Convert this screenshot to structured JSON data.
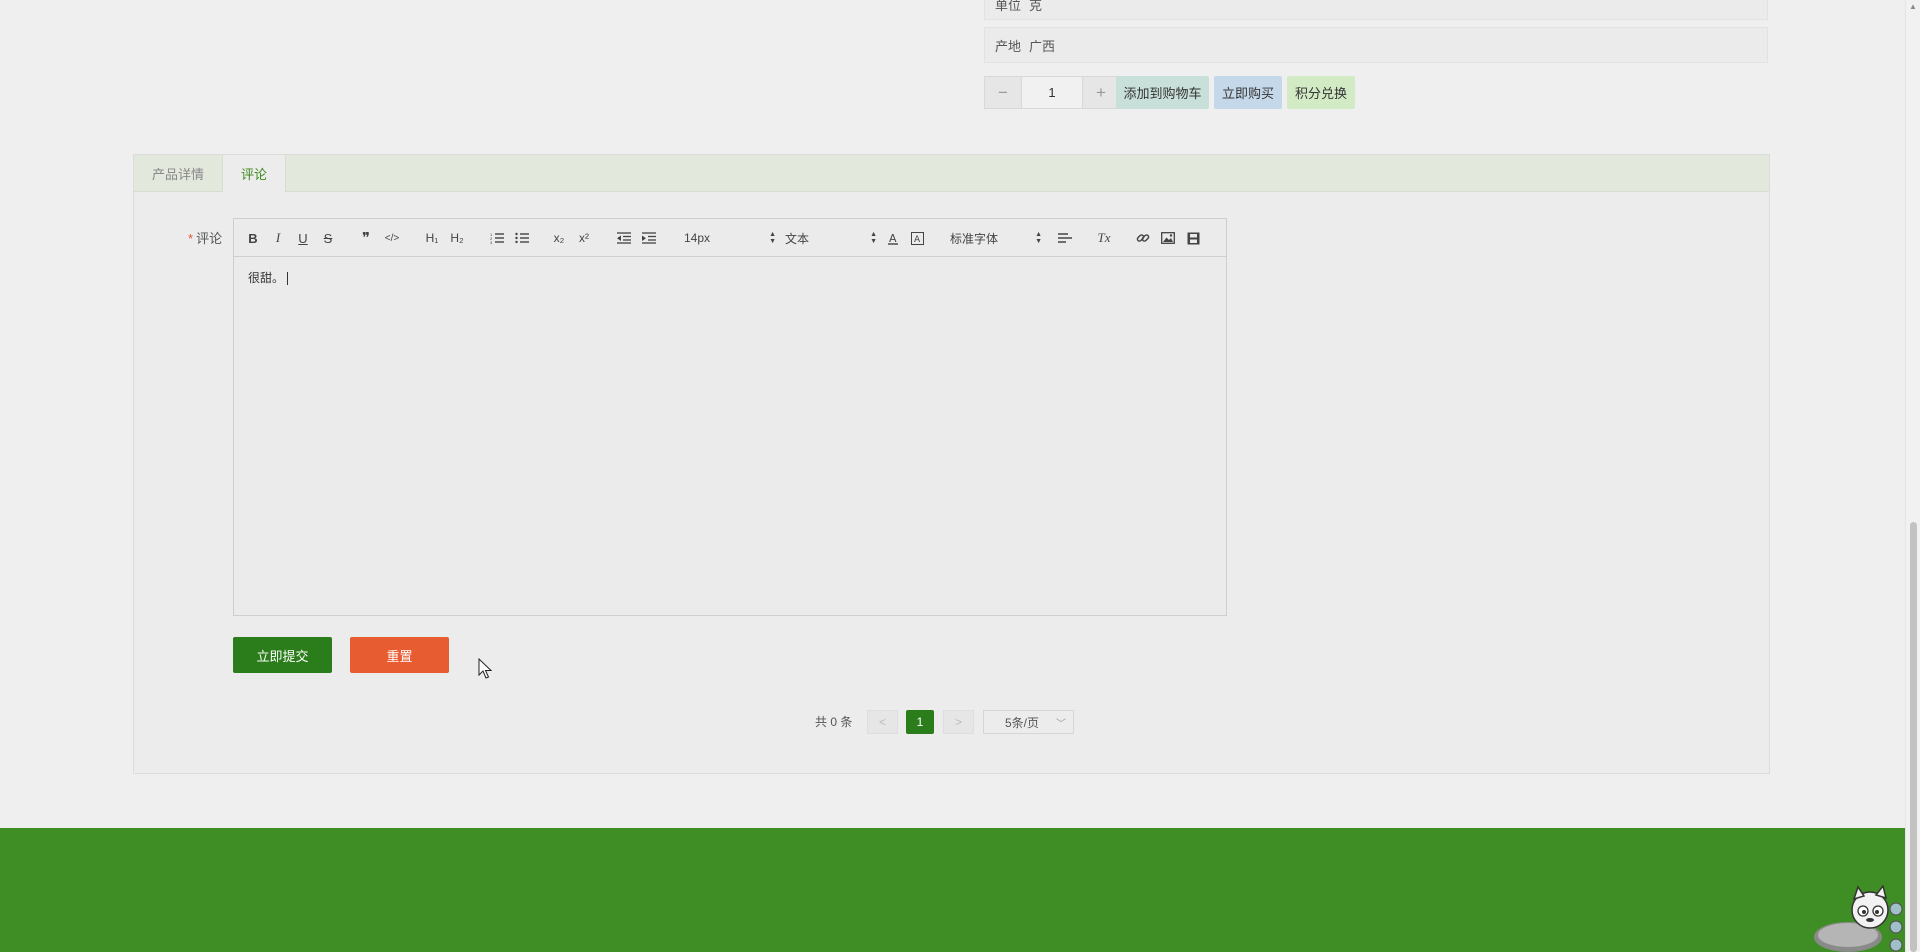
{
  "product_info": {
    "unit_label": "单位",
    "unit_value": "克",
    "origin_label": "产地",
    "origin_value": "广西"
  },
  "quantity": {
    "minus": "−",
    "value": "1",
    "plus": "+"
  },
  "actions": {
    "add_to_cart": "添加到购物车",
    "buy_now": "立即购买",
    "points_exchange": "积分兑换",
    "colors": {
      "add_to_cart": "#c9dfd9",
      "buy_now": "#c4d8ea",
      "points_exchange": "#d3ebc5"
    }
  },
  "tabs": [
    {
      "label": "产品详情",
      "active": false
    },
    {
      "label": "评论",
      "active": true
    }
  ],
  "comment_form": {
    "required_mark": "*",
    "label": "评论",
    "toolbar": {
      "bold": "B",
      "italic": "I",
      "underline": "U",
      "strike": "S",
      "quote": "❞",
      "code": "</>",
      "h1": "H₁",
      "h2": "H₂",
      "sub": "x₂",
      "sup": "x²",
      "size": "14px",
      "header": "文本",
      "font": "标准字体",
      "clean": "Tx"
    },
    "content": "很甜。",
    "submit": "立即提交",
    "reset": "重置"
  },
  "pagination": {
    "total": "共 0 条",
    "prev": "<",
    "current": "1",
    "next": ">",
    "page_size": "5条/页"
  },
  "theme": {
    "primary": "#2a7d1a",
    "footer": "#3f8e25",
    "reset": "#e85c32"
  }
}
